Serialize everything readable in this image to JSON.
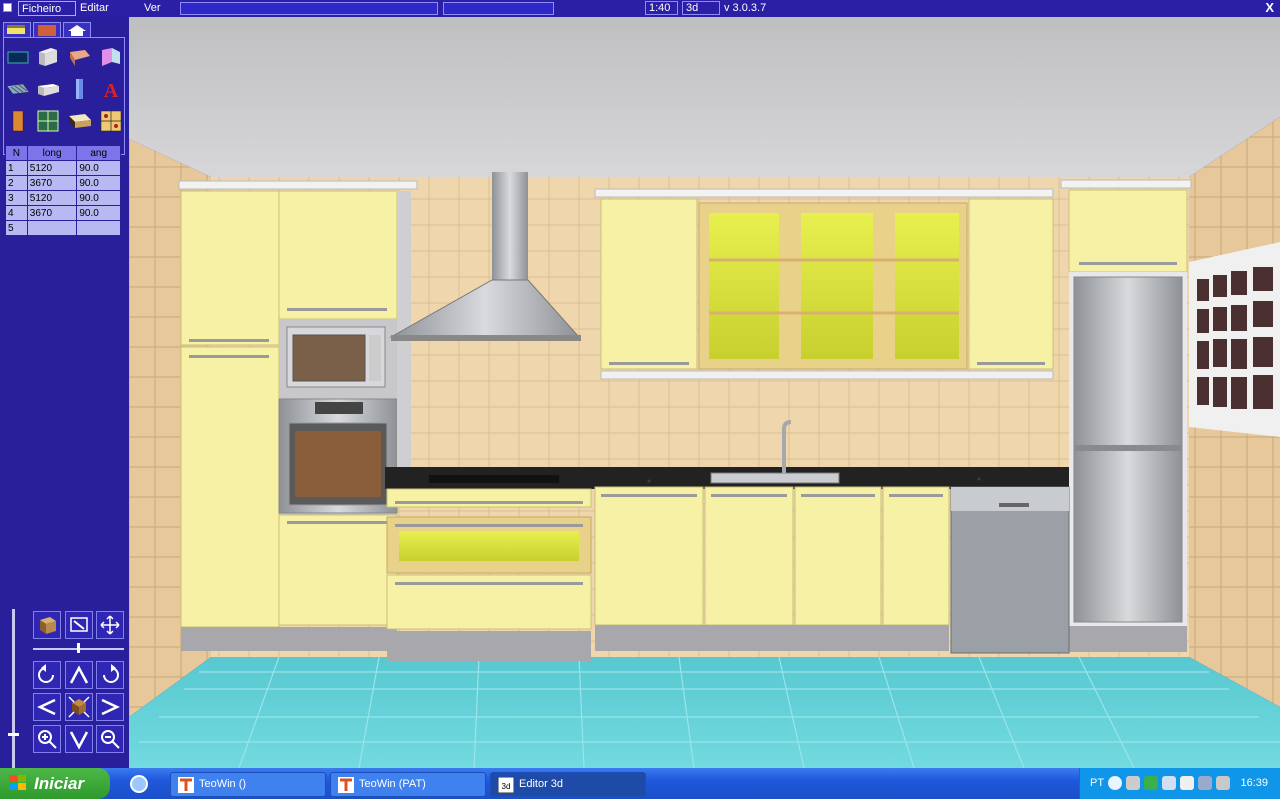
{
  "menu": {
    "ficheiro": "Ficheiro",
    "editar": "Editar",
    "ver": "Ver"
  },
  "toolbar": {
    "scale": "1:40",
    "view_mode": "3d",
    "version": "v 3.0.3.7",
    "close": "X"
  },
  "segments_table": {
    "headers": [
      "N",
      "long",
      "ang"
    ],
    "rows": [
      [
        "1",
        "5120",
        "90.0"
      ],
      [
        "2",
        "3670",
        "90.0"
      ],
      [
        "3",
        "5120",
        "90.0"
      ],
      [
        "4",
        "3670",
        "90.0"
      ],
      [
        "5",
        "",
        ""
      ]
    ]
  },
  "tools": {
    "text_tool_glyph": "A"
  },
  "taskbar": {
    "start_label": "Iniciar",
    "tasks": [
      {
        "label": "TeoWin ()"
      },
      {
        "label": "TeoWin (PAT)"
      },
      {
        "label": "Editor 3d"
      }
    ],
    "language": "PT",
    "clock": "16:39"
  },
  "colors": {
    "panel_bg": "#2a1f9a",
    "cabinet_yellow": "#f7f2a6",
    "floor_cyan": "#5fd0d8",
    "wall_tile": "#f0d8b0"
  }
}
